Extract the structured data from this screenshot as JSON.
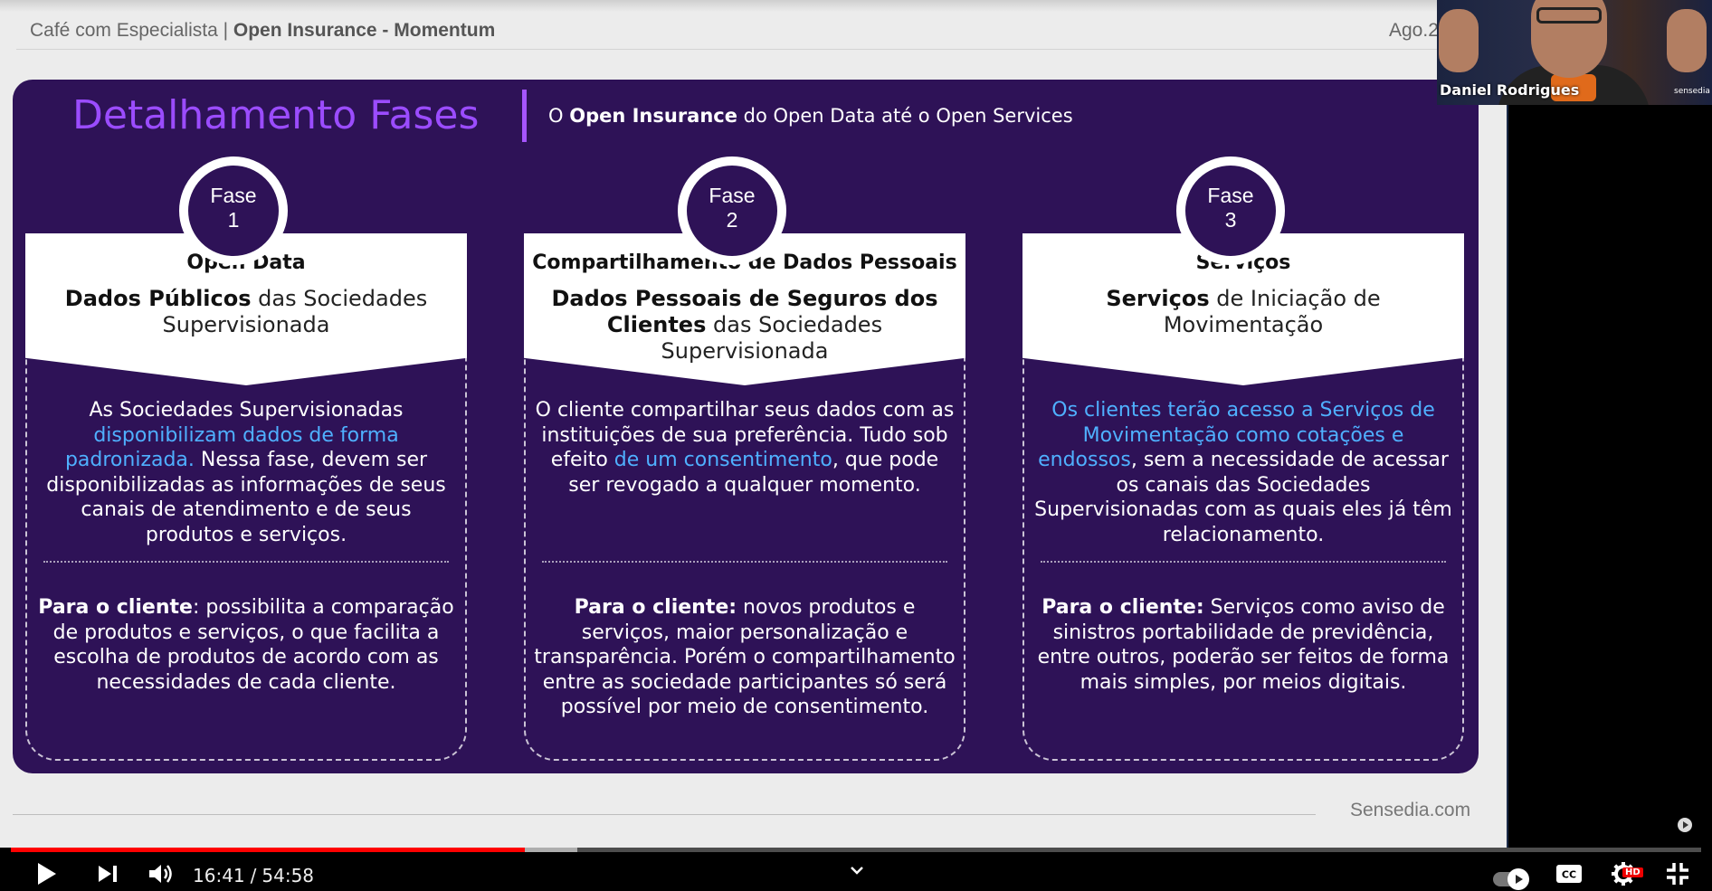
{
  "slide": {
    "header_left_plain": "Café com Especialista | ",
    "header_left_bold": "Open Insurance - Momentum",
    "header_right": "Ago.2",
    "title": "Detalhamento Fases",
    "subtitle_a": "O ",
    "subtitle_b": "Open Insurance",
    "subtitle_c": " do Open Data até o Open Services",
    "footer_brand": "Sensedia.com",
    "phases": [
      {
        "badge_word": "Fase",
        "badge_num": "1",
        "name": "Open Data",
        "desc_bold": "Dados Públicos",
        "desc_plain": " das Sociedades Supervisionada",
        "body_a": "As Sociedades Supervisionadas ",
        "body_hl": "disponibilizam dados de forma padronizada.",
        "body_b": " Nessa fase, devem ser disponibilizadas as informações de seus canais de atendimento e de seus produtos e serviços.",
        "client_bold": "Para o cliente",
        "client_text": ": possibilita a comparação de produtos e serviços, o que facilita a escolha de produtos de acordo com as necessidades de cada cliente."
      },
      {
        "badge_word": "Fase",
        "badge_num": "2",
        "name": "Compartilhamento de Dados Pessoais",
        "desc_bold": "Dados Pessoais de Seguros dos Clientes",
        "desc_plain": " das Sociedades Supervisionada",
        "body_a": "O cliente compartilhar seus dados com as instituições de sua preferência. Tudo sob efeito ",
        "body_hl": "de um consentimento",
        "body_b": ", que pode ser revogado a qualquer momento.",
        "client_bold": "Para o cliente:",
        "client_text": " novos produtos e serviços, maior personalização e transparência. Porém o compartilhamento entre as sociedade participantes só será possível por meio de consentimento."
      },
      {
        "badge_word": "Fase",
        "badge_num": "3",
        "name": "Serviços",
        "desc_bold": "Serviços",
        "desc_plain": " de Iniciação de Movimentação",
        "body_a": "",
        "body_hl": "Os clientes terão acesso a Serviços de Movimentação como cotações e endossos",
        "body_b": ", sem a necessidade de acessar os canais das Sociedades Supervisionadas com as quais eles já têm relacionamento.",
        "client_bold": "Para o cliente:",
        "client_text": " Serviços como aviso de sinistros portabilidade de previdência, entre outros, poderão ser feitos de forma mais simples, por meios digitais."
      }
    ]
  },
  "webcam": {
    "speaker_name": "Daniel Rodrigues",
    "logo_text": "sensedia"
  },
  "player": {
    "current_time": "16:41",
    "separator": "/",
    "duration": "54:58",
    "progress_fraction": 0.304,
    "buffered_fraction": 0.335,
    "hd_label": "HD",
    "colors": {
      "played": "#ff0000",
      "controls": "#ffffff"
    }
  },
  "colors": {
    "panel_bg": "#2e1257",
    "title_purple": "#9b4cff",
    "highlight_blue": "#4fb0ff"
  }
}
